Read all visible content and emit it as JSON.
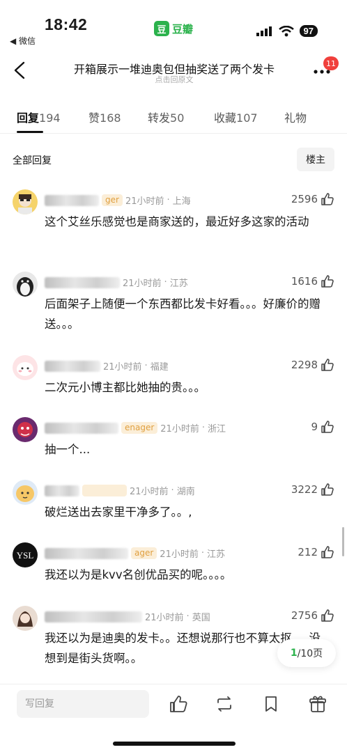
{
  "status_bar": {
    "time": "18:42",
    "back_app": "◀ 微信",
    "app_logo": "豆",
    "app_name": "豆瓣",
    "battery": "97"
  },
  "nav": {
    "title": "开箱展示一堆迪奥包但抽奖送了两个发卡",
    "subtitle": "点击回原文",
    "notification_count": "11"
  },
  "tabs": [
    {
      "label": "回复",
      "count": "194"
    },
    {
      "label": "赞",
      "count": "168"
    },
    {
      "label": "转发",
      "count": "50"
    },
    {
      "label": "收藏",
      "count": "107"
    },
    {
      "label": "礼物",
      "count": ""
    }
  ],
  "section": {
    "label": "全部回复",
    "op_button": "楼主"
  },
  "comments": [
    {
      "badge": "ger",
      "time": "21小时前",
      "location": "上海",
      "likes": "2596",
      "text": "这个艾丝乐感觉也是商家送的，最近好多这家的活动"
    },
    {
      "badge": "",
      "time": "21小时前",
      "location": "江苏",
      "likes": "1616",
      "text": "后面架子上随便一个东西都比发卡好看。。。好廉价的赠送。。。"
    },
    {
      "badge": "",
      "time": "21小时前",
      "location": "福建",
      "likes": "2298",
      "text": "二次元小博主都比她抽的贵。。。"
    },
    {
      "badge": "enager",
      "time": "21小时前",
      "location": "浙江",
      "likes": "9",
      "text": "抽一个..."
    },
    {
      "badge": "",
      "time": "21小时前",
      "location": "湖南",
      "likes": "3222",
      "text": "破烂送出去家里干净多了。。,"
    },
    {
      "badge": "ager",
      "time": "21小时前",
      "location": "江苏",
      "likes": "212",
      "text": "我还以为是kvv名创优品买的呢。。。。"
    },
    {
      "badge": "",
      "time": "21小时前",
      "location": "英国",
      "likes": "2756",
      "text": "我还以为是迪奥的发卡。。还想说那行也不算太抠。。没想到是街头货啊。。"
    }
  ],
  "pager": {
    "current": "1",
    "total": "/10页"
  },
  "bottom_bar": {
    "reply_placeholder": "写回复"
  },
  "colors": {
    "accent": "#2bb24c",
    "badge_red": "#f0403c",
    "badge_bg": "#fbeed8",
    "badge_text": "#e0a040"
  }
}
